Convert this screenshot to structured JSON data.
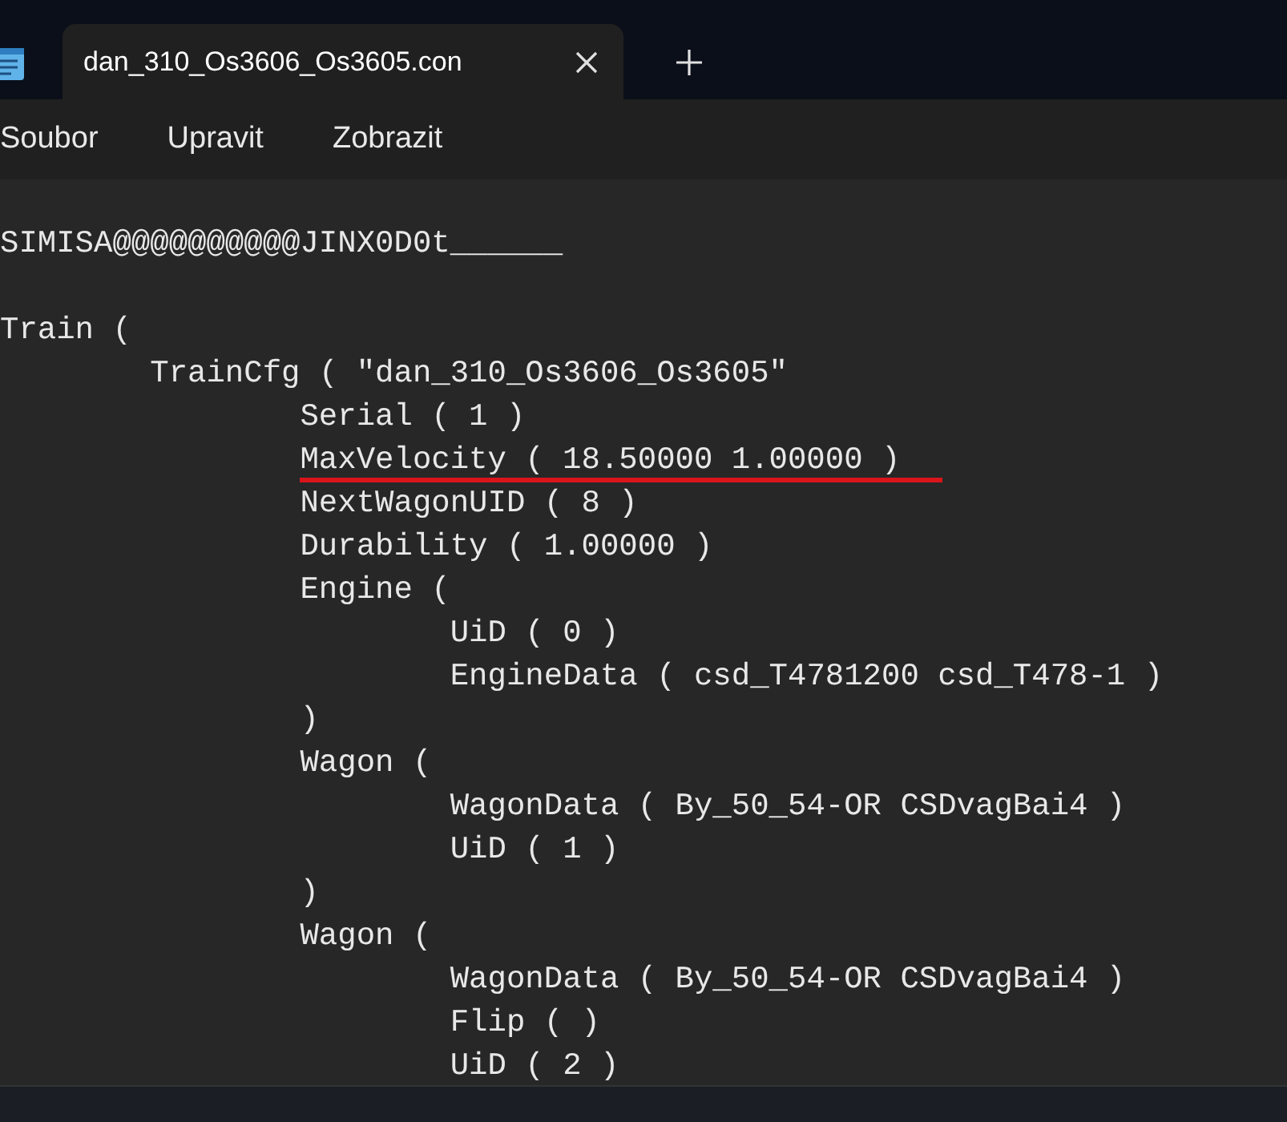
{
  "tab": {
    "title": "dan_310_Os3606_Os3605.con",
    "selected": true
  },
  "menu": [
    "Soubor",
    "Upravit",
    "Zobrazit"
  ],
  "header": "SIMISA@@@@@@@@@@JINX0D0t______",
  "lines": [
    {
      "text": "Train (",
      "underlined": false
    },
    {
      "text": "\tTrainCfg ( \"dan_310_Os3606_Os3605\"",
      "underlined": false
    },
    {
      "text": "\t\tSerial ( 1 )",
      "underlined": false
    },
    {
      "text": "\t\tMaxVelocity ( 18.50000 1.00000 )",
      "underlined": true
    },
    {
      "text": "\t\tNextWagonUID ( 8 )",
      "underlined": false
    },
    {
      "text": "\t\tDurability ( 1.00000 )",
      "underlined": false
    },
    {
      "text": "\t\tEngine (",
      "underlined": false
    },
    {
      "text": "\t\t\tUiD ( 0 )",
      "underlined": false
    },
    {
      "text": "\t\t\tEngineData ( csd_T4781200 csd_T478-1 )",
      "underlined": false
    },
    {
      "text": "\t\t)",
      "underlined": false
    },
    {
      "text": "\t\tWagon (",
      "underlined": false
    },
    {
      "text": "\t\t\tWagonData ( By_50_54-OR CSDvagBai4 )",
      "underlined": false
    },
    {
      "text": "\t\t\tUiD ( 1 )",
      "underlined": false
    },
    {
      "text": "\t\t)",
      "underlined": false
    },
    {
      "text": "\t\tWagon (",
      "underlined": false
    },
    {
      "text": "\t\t\tWagonData ( By_50_54-OR CSDvagBai4 )",
      "underlined": false
    },
    {
      "text": "\t\t\tFlip ( )",
      "underlined": false
    },
    {
      "text": "\t\t\tUiD ( 2 )",
      "underlined": false
    }
  ]
}
